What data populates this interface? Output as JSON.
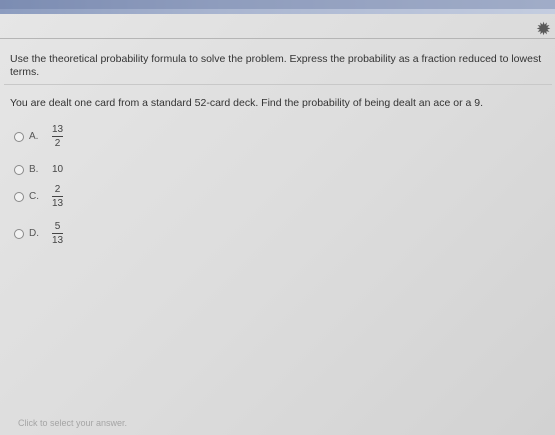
{
  "header": {
    "settings_icon": "gear-icon"
  },
  "instructions": "Use the theoretical probability formula to solve the problem. Express the probability as a fraction reduced to lowest terms.",
  "question": "You are dealt one card from a standard 52-card deck. Find the probability of being dealt an ace or a 9.",
  "options": [
    {
      "letter": "A.",
      "numerator": "13",
      "denominator": "2"
    },
    {
      "letter": "B.",
      "value": "10"
    },
    {
      "letter": "C.",
      "numerator": "2",
      "denominator": "13"
    },
    {
      "letter": "D.",
      "numerator": "5",
      "denominator": "13"
    }
  ],
  "footer": {
    "hint": "Click to select your answer."
  }
}
